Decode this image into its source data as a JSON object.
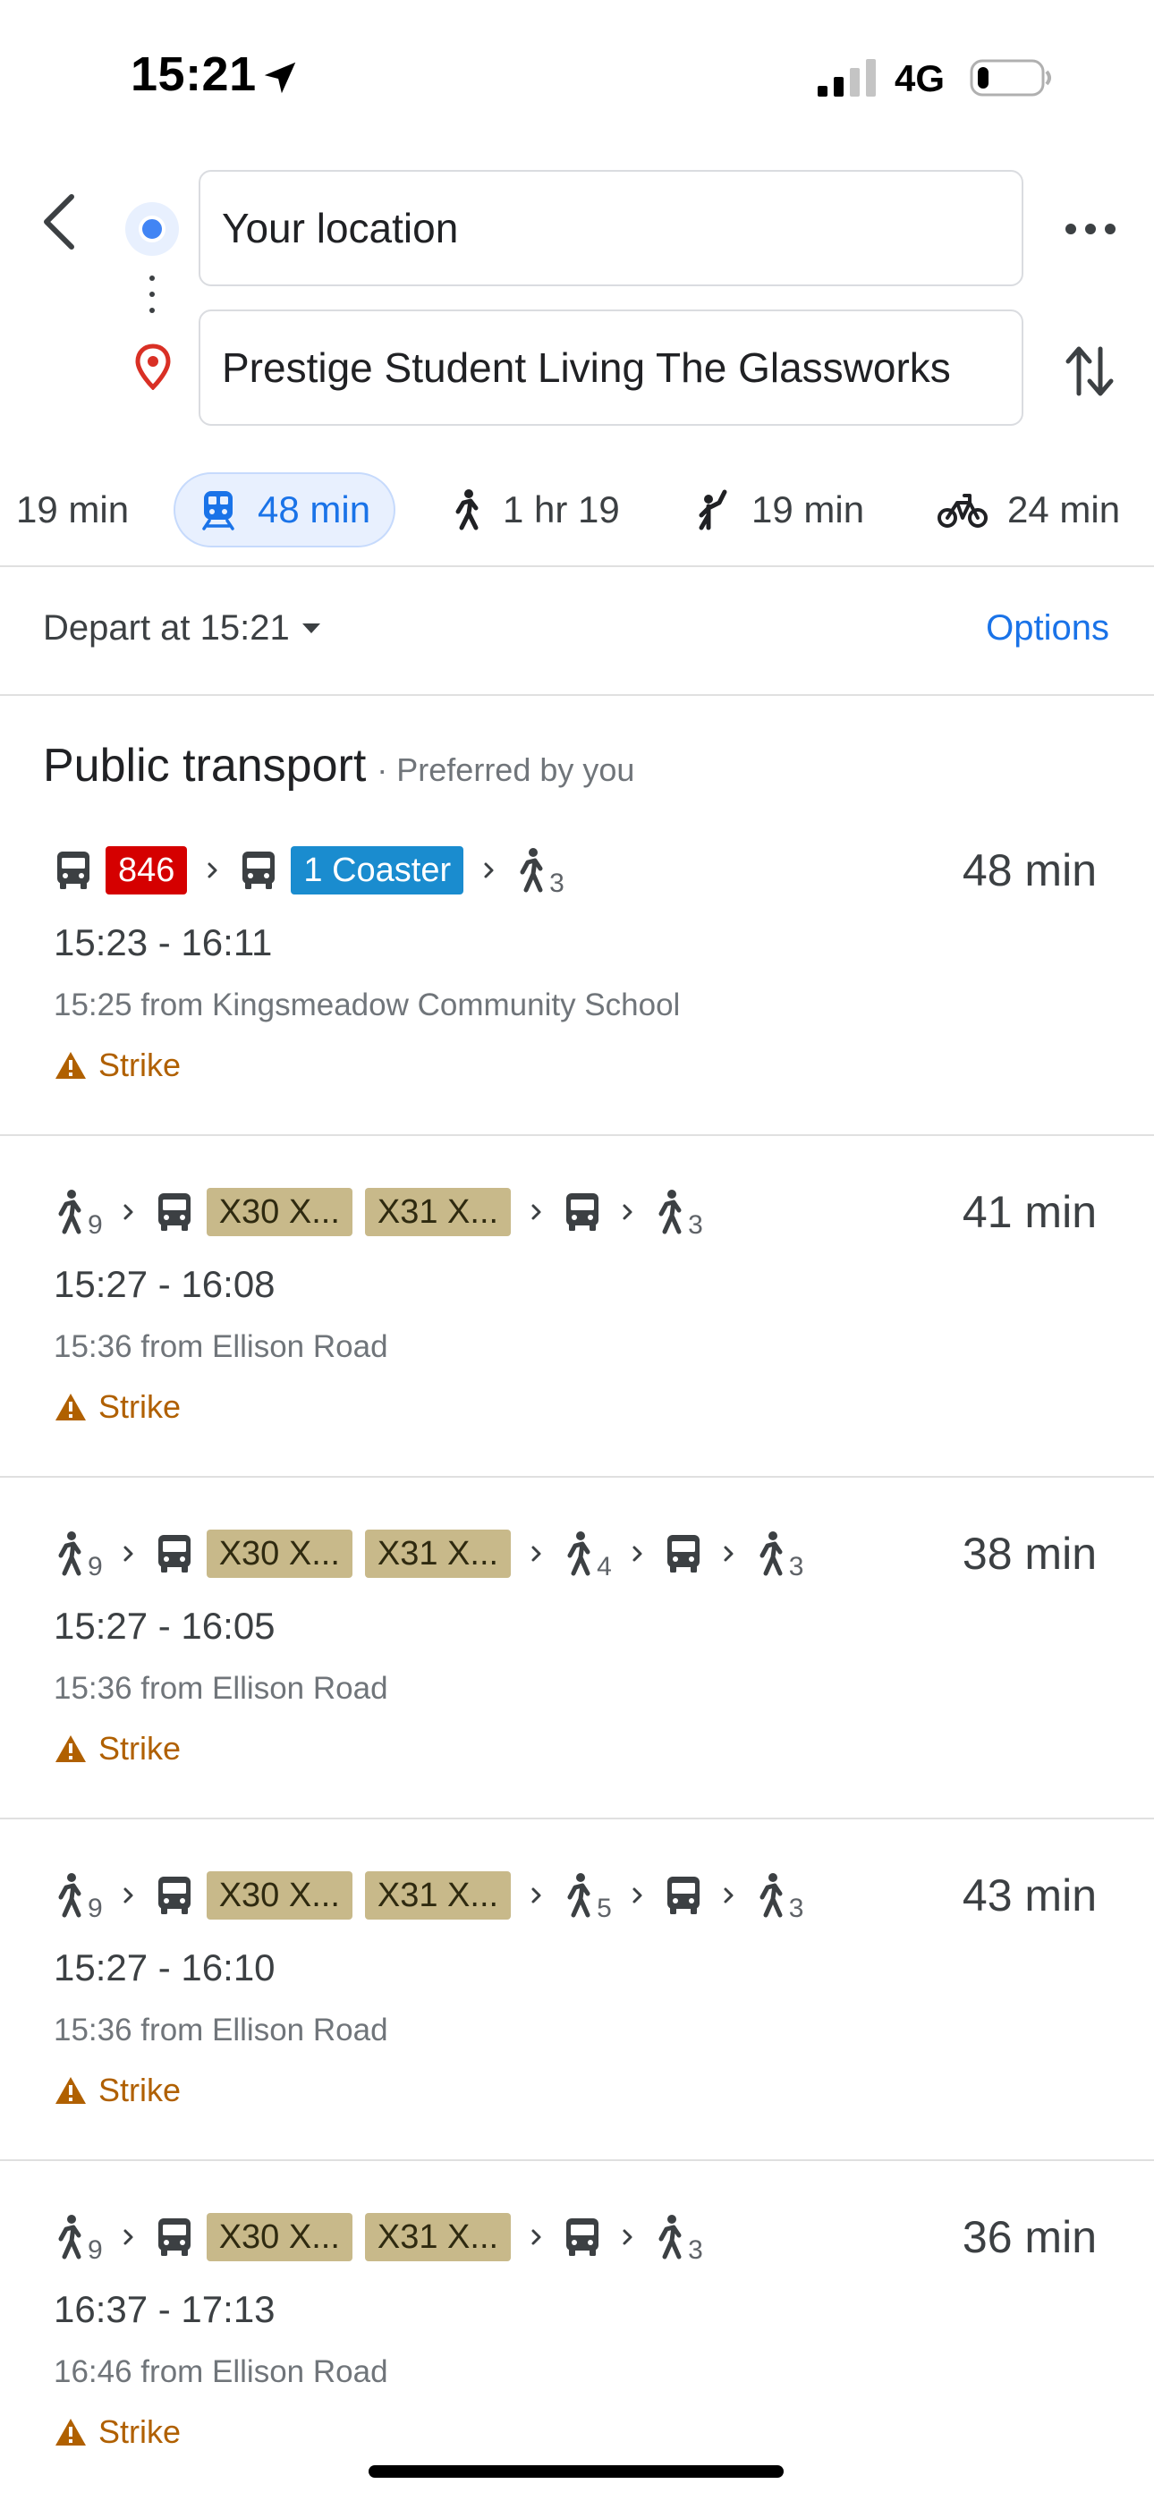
{
  "status_bar": {
    "time": "15:21",
    "network": "4G",
    "battery_level": 0.18
  },
  "search": {
    "origin": "Your location",
    "destination": "Prestige Student Living The Glassworks"
  },
  "mode_tabs": [
    {
      "mode": "drive",
      "icon": "car-icon",
      "label": "19 min",
      "active": false
    },
    {
      "mode": "transit",
      "icon": "train-icon",
      "label": "48 min",
      "active": true
    },
    {
      "mode": "walk",
      "icon": "walk-icon",
      "label": "1 hr 19",
      "active": false
    },
    {
      "mode": "ride-hail",
      "icon": "hail-icon",
      "label": "19 min",
      "active": false
    },
    {
      "mode": "cycle",
      "icon": "bicycle-icon",
      "label": "24 min",
      "active": false
    }
  ],
  "depart": {
    "label": "Depart at 15:21",
    "options_label": "Options"
  },
  "section": {
    "title": "Public transport",
    "subtitle": "· Preferred by you"
  },
  "colors": {
    "accent": "#1a73e8",
    "badge_846": "#d50000",
    "badge_coaster": "#1a8ccf",
    "badge_x": "#c8b98a",
    "alert": "#b06000"
  },
  "routes": [
    {
      "duration": "48 min",
      "times": "15:23 - 16:11",
      "from": "15:25 from Kingsmeadow Community School",
      "alert": "Strike",
      "steps": [
        {
          "type": "bus"
        },
        {
          "type": "badge",
          "text": "846",
          "style": "red"
        },
        {
          "type": "chevron"
        },
        {
          "type": "bus"
        },
        {
          "type": "badge",
          "text": "1 Coaster",
          "style": "blue"
        },
        {
          "type": "chevron"
        },
        {
          "type": "walk",
          "sub": "3"
        }
      ]
    },
    {
      "duration": "41 min",
      "times": "15:27 - 16:08",
      "from": "15:36 from Ellison Road",
      "alert": "Strike",
      "steps": [
        {
          "type": "walk",
          "sub": "9"
        },
        {
          "type": "chevron"
        },
        {
          "type": "bus"
        },
        {
          "type": "badge",
          "text": "X30 X...",
          "style": "tan"
        },
        {
          "type": "badge",
          "text": "X31 X...",
          "style": "tan"
        },
        {
          "type": "chevron"
        },
        {
          "type": "bus"
        },
        {
          "type": "chevron"
        },
        {
          "type": "walk",
          "sub": "3"
        }
      ]
    },
    {
      "duration": "38 min",
      "times": "15:27 - 16:05",
      "from": "15:36 from Ellison Road",
      "alert": "Strike",
      "steps": [
        {
          "type": "walk",
          "sub": "9"
        },
        {
          "type": "chevron"
        },
        {
          "type": "bus"
        },
        {
          "type": "badge",
          "text": "X30 X...",
          "style": "tan"
        },
        {
          "type": "badge",
          "text": "X31 X...",
          "style": "tan"
        },
        {
          "type": "chevron"
        },
        {
          "type": "walk",
          "sub": "4"
        },
        {
          "type": "chevron"
        },
        {
          "type": "bus"
        },
        {
          "type": "chevron"
        },
        {
          "type": "walk",
          "sub": "3"
        }
      ]
    },
    {
      "duration": "43 min",
      "times": "15:27 - 16:10",
      "from": "15:36 from Ellison Road",
      "alert": "Strike",
      "steps": [
        {
          "type": "walk",
          "sub": "9"
        },
        {
          "type": "chevron"
        },
        {
          "type": "bus"
        },
        {
          "type": "badge",
          "text": "X30 X...",
          "style": "tan"
        },
        {
          "type": "badge",
          "text": "X31 X...",
          "style": "tan"
        },
        {
          "type": "chevron"
        },
        {
          "type": "walk",
          "sub": "5"
        },
        {
          "type": "chevron"
        },
        {
          "type": "bus"
        },
        {
          "type": "chevron"
        },
        {
          "type": "walk",
          "sub": "3"
        }
      ]
    },
    {
      "duration": "36 min",
      "times": "16:37 - 17:13",
      "from": "16:46 from Ellison Road",
      "alert": "Strike",
      "steps": [
        {
          "type": "walk",
          "sub": "9"
        },
        {
          "type": "chevron"
        },
        {
          "type": "bus"
        },
        {
          "type": "badge",
          "text": "X30 X...",
          "style": "tan"
        },
        {
          "type": "badge",
          "text": "X31 X...",
          "style": "tan"
        },
        {
          "type": "chevron"
        },
        {
          "type": "bus"
        },
        {
          "type": "chevron"
        },
        {
          "type": "walk",
          "sub": "3"
        }
      ]
    }
  ]
}
